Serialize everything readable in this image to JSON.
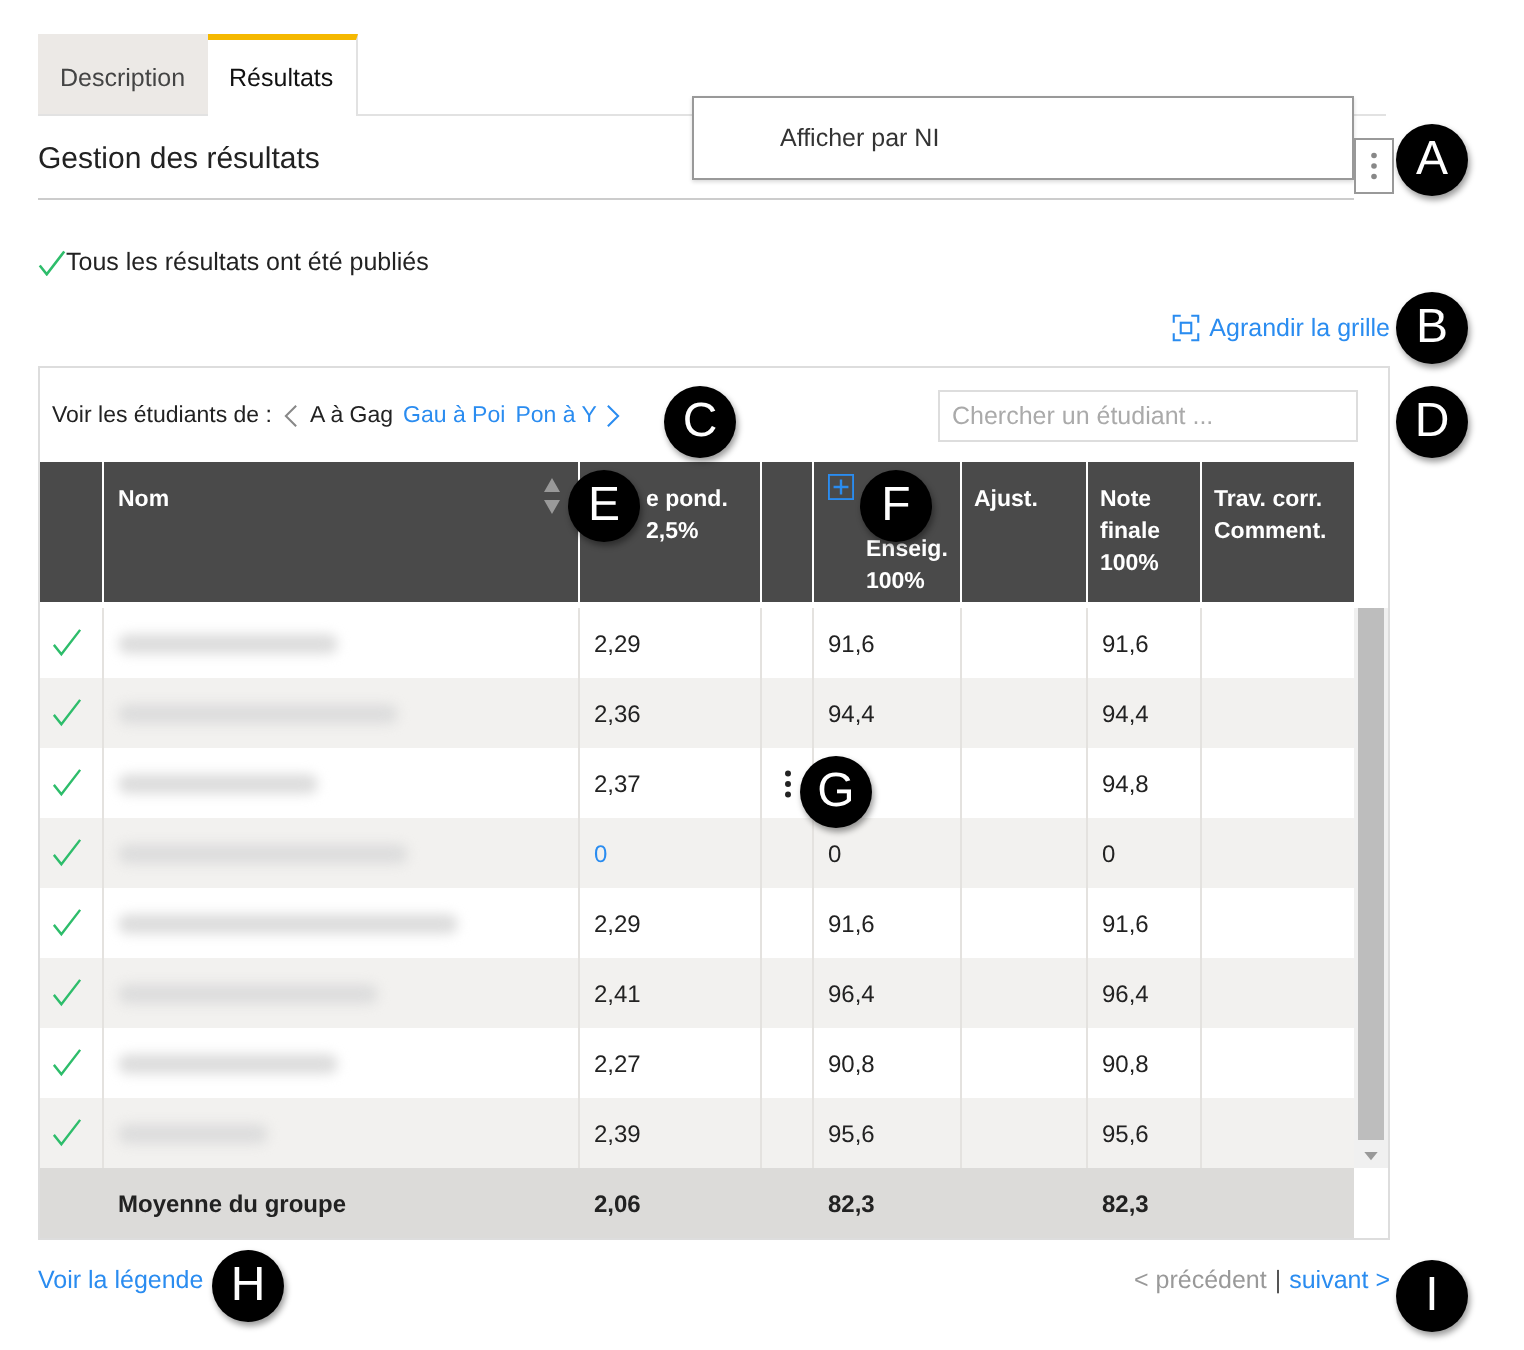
{
  "tabs": [
    {
      "label": "Description",
      "selected": false
    },
    {
      "label": "Résultats",
      "selected": true
    }
  ],
  "section_title": "Gestion des résultats",
  "menu": {
    "items": [
      "Afficher par NI"
    ]
  },
  "status": {
    "published": true,
    "text": "Tous les résultats ont été publiés"
  },
  "expand_link": "Agrandir la grille",
  "filter": {
    "label": "Voir les étudiants de :",
    "groups": [
      {
        "label": "A à Gag",
        "selected": true
      },
      {
        "label": "Gau à Poi",
        "selected": false
      },
      {
        "label": "Pon à Y",
        "selected": false
      }
    ]
  },
  "search": {
    "placeholder": "Chercher un étudiant ..."
  },
  "columns": [
    {},
    {
      "lines": [
        "Nom"
      ],
      "sortable": true
    },
    {
      "lines": [
        "e pond.",
        "2,5%"
      ]
    },
    {},
    {
      "lines": [
        "Enseig.",
        "100%"
      ],
      "expandable": true
    },
    {
      "lines": [
        "Ajust."
      ]
    },
    {
      "lines": [
        "Note",
        "finale",
        "100%"
      ]
    },
    {
      "lines": [
        "Trav. corr.",
        "Comment."
      ]
    }
  ],
  "rows": [
    {
      "published": true,
      "pond": "2,29",
      "menu": false,
      "enseig": "91,6",
      "finale": "91,6"
    },
    {
      "published": true,
      "pond": "2,36",
      "menu": false,
      "enseig": "94,4",
      "finale": "94,4"
    },
    {
      "published": true,
      "pond": "2,37",
      "menu": true,
      "finale": "94,8"
    },
    {
      "published": true,
      "pond": "0",
      "pond_link": true,
      "menu": false,
      "enseig": "0",
      "finale": "0"
    },
    {
      "published": true,
      "pond": "2,29",
      "menu": false,
      "enseig": "91,6",
      "finale": "91,6"
    },
    {
      "published": true,
      "pond": "2,41",
      "menu": false,
      "enseig": "96,4",
      "finale": "96,4"
    },
    {
      "published": true,
      "pond": "2,27",
      "menu": false,
      "enseig": "90,8",
      "finale": "90,8"
    },
    {
      "published": true,
      "pond": "2,39",
      "menu": false,
      "enseig": "95,6",
      "finale": "95,6"
    }
  ],
  "footer": {
    "label": "Moyenne du groupe",
    "pond": "2,06",
    "enseig": "82,3",
    "finale": "82,3"
  },
  "legend_link": "Voir la légende",
  "pagination": {
    "previous_arrow": "<",
    "previous": "précédent",
    "next_arrow": ">",
    "previous_disabled": true,
    "separator": "|",
    "next": "suivant"
  },
  "callouts": [
    "A",
    "B",
    "C",
    "D",
    "E",
    "F",
    "G",
    "H",
    "I"
  ]
}
